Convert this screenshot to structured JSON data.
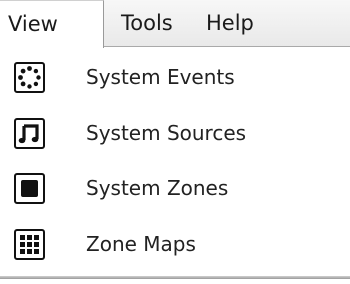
{
  "menubar": {
    "items": [
      {
        "label": "View"
      },
      {
        "label": "Tools"
      },
      {
        "label": "Help"
      }
    ]
  },
  "dropdown": {
    "items": [
      {
        "label": "System Events",
        "icon": "spinner-icon"
      },
      {
        "label": "System Sources",
        "icon": "music-note-icon"
      },
      {
        "label": "System Zones",
        "icon": "filled-square-icon"
      },
      {
        "label": "Zone Maps",
        "icon": "grid-icon"
      }
    ]
  }
}
